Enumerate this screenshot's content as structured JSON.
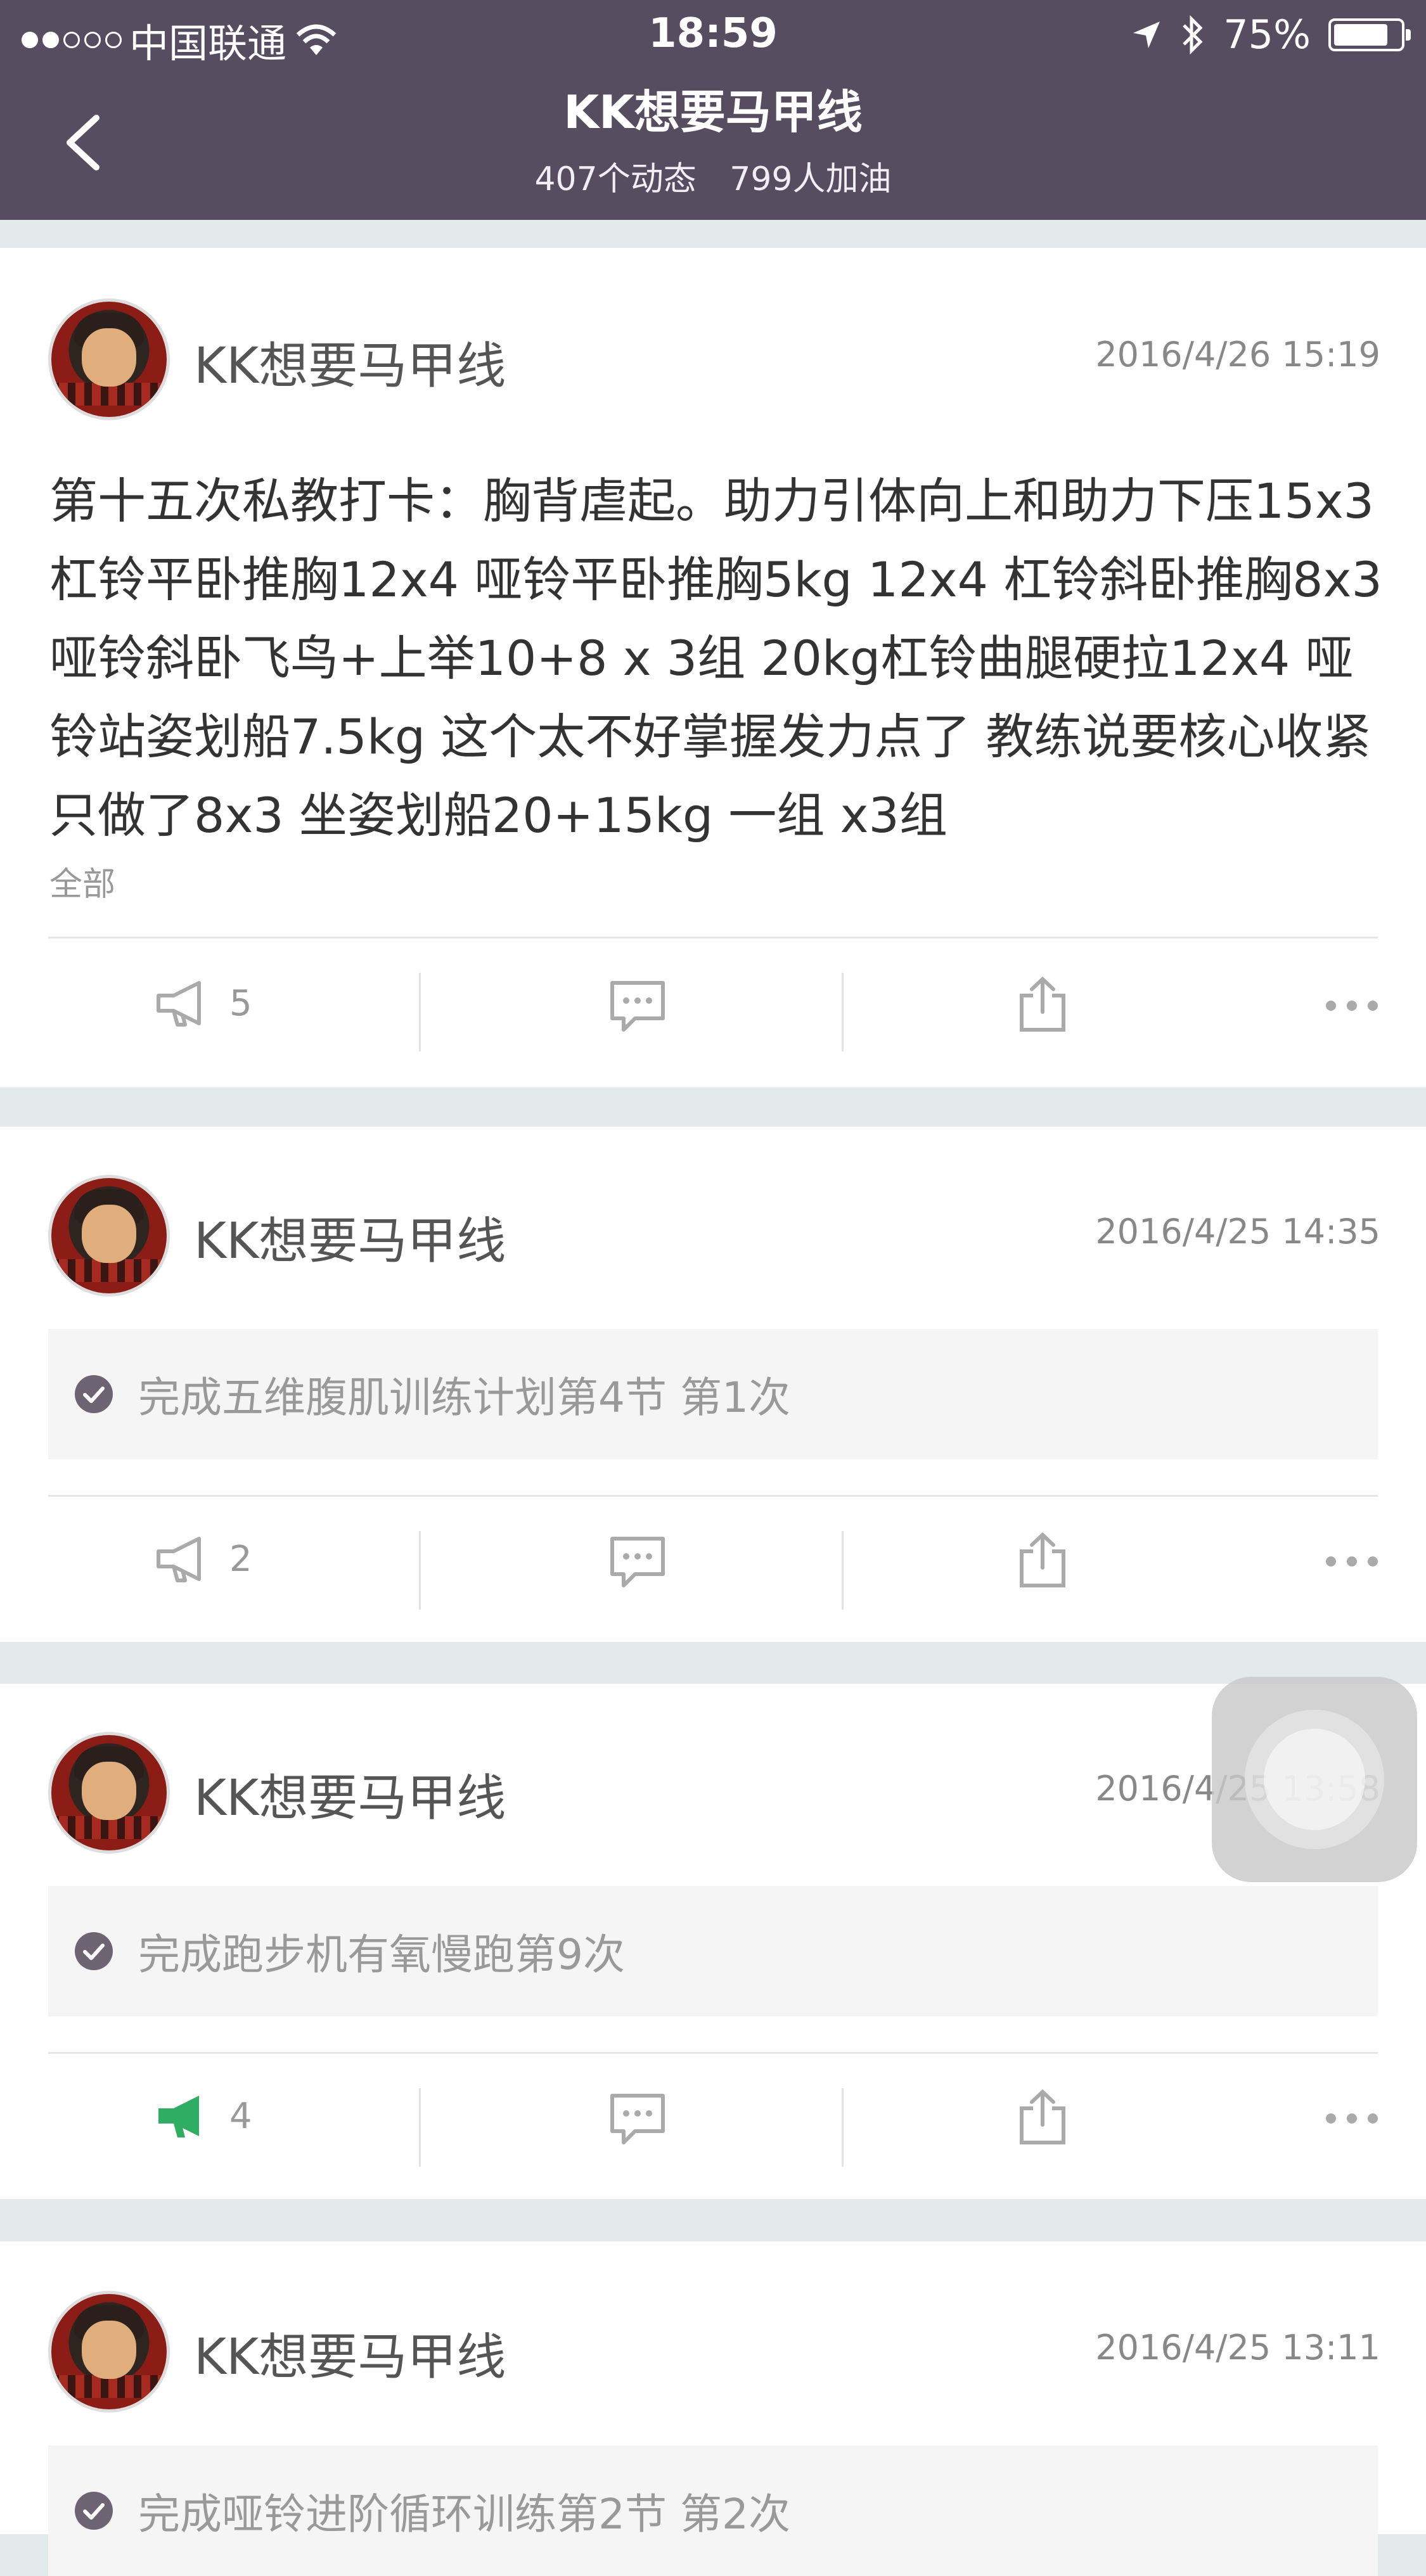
{
  "status_bar": {
    "carrier": "中国联通",
    "time": "18:59",
    "battery": "75%",
    "battery_level": 0.75,
    "signal_bars_filled": 2,
    "signal_bars_total": 5
  },
  "nav": {
    "title": "KK想要马甲线",
    "posts_count": "407个动态",
    "cheers_count": "799人加油"
  },
  "colors": {
    "nav_bg": "#564d61",
    "cheer_active": "#2fae63",
    "check_icon": "#6d6372"
  },
  "posts": [
    {
      "username": "KK想要马甲线",
      "timestamp": "2016/4/26 15:19",
      "text": "第十五次私教打卡：胸背虐起。助力引体向上和助力下压15x3 杠铃平卧推胸12x4 哑铃平卧推胸5kg 12x4 杠铃斜卧推胸8x3 哑铃斜卧飞鸟+上举10+8 x 3组 20kg杠铃曲腿硬拉12x4 哑铃站姿划船7.5kg 这个太不好掌握发力点了 教练说要核心收紧 只做了8x3 坐姿划船20+15kg 一组 x3组",
      "more": "全部",
      "cheers": "5",
      "cheered": false
    },
    {
      "username": "KK想要马甲线",
      "timestamp": "2016/4/25 14:35",
      "plan": "完成五维腹肌训练计划第4节 第1次",
      "cheers": "2",
      "cheered": false
    },
    {
      "username": "KK想要马甲线",
      "timestamp": "2016/4/25 13:58",
      "plan": "完成跑步机有氧慢跑第9次",
      "cheers": "4",
      "cheered": true
    },
    {
      "username": "KK想要马甲线",
      "timestamp": "2016/4/25 13:11",
      "plan": "完成哑铃进阶循环训练第2节 第2次"
    }
  ]
}
